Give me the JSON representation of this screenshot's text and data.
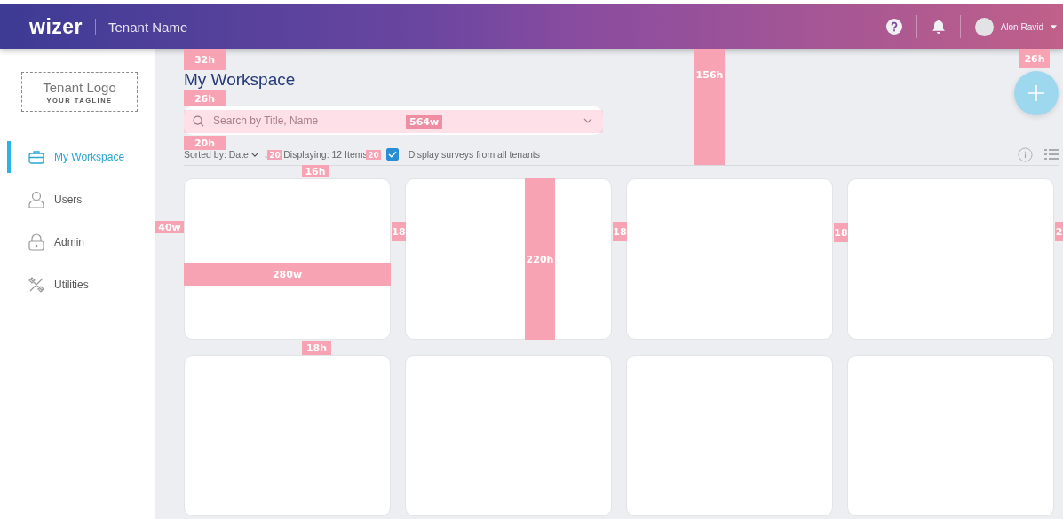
{
  "header": {
    "logo": "wizer",
    "tenant_name": "Tenant Name",
    "user_name": "Alon Ravid"
  },
  "sidebar": {
    "logo_title": "Tenant Logo",
    "logo_tagline": "YOUR TAGLINE",
    "items": [
      {
        "label": "My Workspace",
        "selected": true
      },
      {
        "label": "Users",
        "selected": false
      },
      {
        "label": "Admin",
        "selected": false
      },
      {
        "label": "Utilities",
        "selected": false
      }
    ]
  },
  "page_title": "My Workspace",
  "search": {
    "placeholder": "Search by Title, Name"
  },
  "toolbar": {
    "sort_label": "Sorted by: Date",
    "sort_direction": "↓",
    "count": "Displaying: 12 Items",
    "all_tenants": {
      "label": "Display surveys from all tenants",
      "checked": true
    }
  },
  "cards": [
    {
      "kind": "blank"
    },
    {
      "kind": "blank"
    },
    {
      "kind": "blank"
    },
    {
      "kind": "blank"
    },
    {
      "kind": "blank"
    },
    {
      "kind": "blank"
    },
    {
      "kind": "blank"
    },
    {
      "kind": "blank"
    }
  ],
  "annotations": [
    {
      "label": "32h"
    },
    {
      "label": "26h"
    },
    {
      "label": "564w"
    },
    {
      "label": "20h"
    },
    {
      "label": "20"
    },
    {
      "label": "20"
    },
    {
      "label": "16h"
    },
    {
      "label": "40w"
    },
    {
      "label": "18"
    },
    {
      "label": "18"
    },
    {
      "label": "18"
    },
    {
      "label": "2"
    },
    {
      "label": "280w"
    },
    {
      "label": "220h"
    },
    {
      "label": "18h"
    },
    {
      "label": "156h"
    },
    {
      "label": "26h"
    }
  ]
}
